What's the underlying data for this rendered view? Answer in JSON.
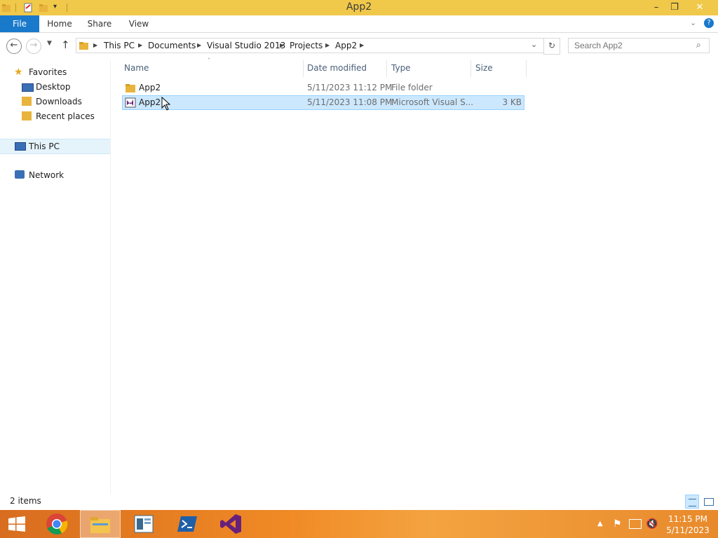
{
  "window": {
    "title": "App2"
  },
  "ribbon": {
    "tabs": [
      "File",
      "Home",
      "Share",
      "View"
    ]
  },
  "address": {
    "crumbs": [
      "This PC",
      "Documents",
      "Visual Studio 2013",
      "Projects",
      "App2"
    ],
    "search_placeholder": "Search App2"
  },
  "navpane": {
    "favorites": "Favorites",
    "favorites_items": [
      "Desktop",
      "Downloads",
      "Recent places"
    ],
    "this_pc": "This PC",
    "network": "Network"
  },
  "columns": {
    "name": "Name",
    "date": "Date modified",
    "type": "Type",
    "size": "Size"
  },
  "files": [
    {
      "name": "App2",
      "date": "5/11/2023 11:12 PM",
      "type": "File folder",
      "size": "",
      "icon": "folder-icon",
      "selected": false
    },
    {
      "name": "App2",
      "date": "5/11/2023 11:08 PM",
      "type": "Microsoft Visual S...",
      "size": "3 KB",
      "icon": "vs-solution-icon",
      "selected": true
    }
  ],
  "status": {
    "items": "2 items"
  },
  "taskbar": {
    "apps": [
      "start-button",
      "chrome-icon",
      "file-explorer-icon",
      "server-manager-icon",
      "powershell-icon",
      "visual-studio-icon"
    ],
    "time": "11:15 PM",
    "date": "5/11/2023"
  },
  "colors": {
    "titlebar": "#f0c84a",
    "accent": "#1979ca",
    "selection": "#cce8ff"
  }
}
